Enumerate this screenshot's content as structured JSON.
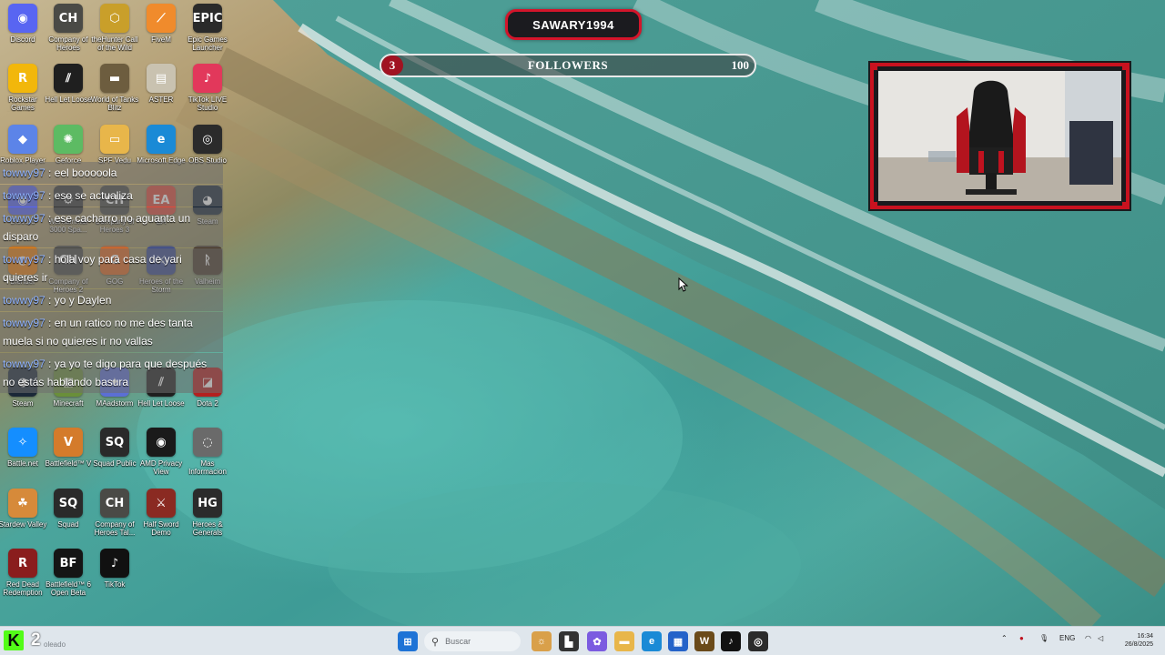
{
  "desktop_icons": [
    {
      "label": "Discord",
      "glyph": "◉",
      "color": "#5865f2",
      "icon": "discord-icon"
    },
    {
      "label": "Company of Heroes",
      "glyph": "CH",
      "color": "#4a4a46",
      "icon": "company-of-heroes-icon"
    },
    {
      "label": "theHunter Call of the Wild",
      "glyph": "⬡",
      "color": "#c99f2a",
      "icon": "thehunter-icon"
    },
    {
      "label": "FiveM",
      "glyph": "⟋",
      "color": "#f08b2c",
      "icon": "fivem-icon"
    },
    {
      "label": "Epic Games Launcher",
      "glyph": "EPIC",
      "color": "#2a2a2a",
      "icon": "epic-games-icon"
    },
    {
      "label": "Rockstar Games Launcher",
      "glyph": "R",
      "color": "#f2b70b",
      "icon": "rockstar-icon"
    },
    {
      "label": "Hell Let Loose",
      "glyph": "⫽",
      "color": "#1f1f1f",
      "icon": "hell-let-loose-icon"
    },
    {
      "label": "World of Tanks Blitz",
      "glyph": "▬",
      "color": "#6d5d3f",
      "icon": "world-of-tanks-icon"
    },
    {
      "label": "ASTER",
      "glyph": "▤",
      "color": "#c9c2b0",
      "icon": "aster-icon"
    },
    {
      "label": "TikTok LIVE Studio",
      "glyph": "♪",
      "color": "#e2385b",
      "icon": "tiktok-live-studio-icon"
    },
    {
      "label": "Roblox Player",
      "glyph": "◆",
      "color": "#5c84e8",
      "icon": "roblox-icon"
    },
    {
      "label": "Geforce",
      "glyph": "✺",
      "color": "#5dbb63",
      "icon": "geforce-icon"
    },
    {
      "label": "SPF Vedu",
      "glyph": "▭",
      "color": "#e8b64a",
      "icon": "folder-icon"
    },
    {
      "label": "Microsoft Edge",
      "glyph": "e",
      "color": "#1a8ad6",
      "icon": "edge-icon"
    },
    {
      "label": "OBS Studio",
      "glyph": "◎",
      "color": "#2b2b2b",
      "icon": "obs-icon"
    },
    {
      "label": "Discord",
      "glyph": "◉",
      "color": "#5865f2",
      "icon": "discord-icon"
    },
    {
      "label": "Warhammer 3000 Spa...",
      "glyph": "⚙",
      "color": "#3a3a3a",
      "icon": "warhammer-icon"
    },
    {
      "label": "Company of Heroes 3",
      "glyph": "CH",
      "color": "#4a4a46",
      "icon": "company-of-heroes-icon"
    },
    {
      "label": "EA",
      "glyph": "EA",
      "color": "#e04a3a",
      "icon": "ea-icon"
    },
    {
      "label": "Steam",
      "glyph": "◕",
      "color": "#1b2838",
      "icon": "steam-icon"
    },
    {
      "label": "Blender",
      "glyph": "◐",
      "color": "#e87d0d",
      "icon": "blender-icon"
    },
    {
      "label": "Company of Heroes 2",
      "glyph": "CH",
      "color": "#4a4a46",
      "icon": "company-of-heroes-icon"
    },
    {
      "label": "GOG",
      "glyph": "G",
      "color": "#e0661f",
      "icon": "gog-icon"
    },
    {
      "label": "Heroes of the Storm",
      "glyph": "⚔",
      "color": "#3b4b8f",
      "icon": "heroes-storm-icon"
    },
    {
      "label": "Valheim",
      "glyph": "ᚱ",
      "color": "#4b3a2a",
      "icon": "valheim-icon"
    },
    {
      "label": "Steam",
      "glyph": "◕",
      "color": "#1b2838",
      "icon": "steam-icon"
    },
    {
      "label": "Minecraft",
      "glyph": "▦",
      "color": "#6a8f3a",
      "icon": "minecraft-icon"
    },
    {
      "label": "MAadstorm",
      "glyph": "✦",
      "color": "#5b6fd4",
      "icon": "maadstorm-icon"
    },
    {
      "label": "Hell Let Loose",
      "glyph": "⫽",
      "color": "#1f1f1f",
      "icon": "hell-let-loose-icon"
    },
    {
      "label": "Dota 2",
      "glyph": "◪",
      "color": "#b3201f",
      "icon": "dota-icon"
    },
    {
      "label": "Battle.net",
      "glyph": "✧",
      "color": "#148eff",
      "icon": "battlenet-icon"
    },
    {
      "label": "Battlefield™ V",
      "glyph": "V",
      "color": "#d47b2b",
      "icon": "battlefield-v-icon"
    },
    {
      "label": "Squad Public",
      "glyph": "SQ",
      "color": "#2a2a2a",
      "icon": "squad-icon"
    },
    {
      "label": "AMD Privacy View",
      "glyph": "◉",
      "color": "#1a1a1a",
      "icon": "amd-privacy-view-icon"
    },
    {
      "label": "Mas Informacion",
      "glyph": "◌",
      "color": "#6a6a6a",
      "icon": "info-icon"
    },
    {
      "label": "Stardew Valley",
      "glyph": "☘",
      "color": "#d68a3a",
      "icon": "stardew-valley-icon"
    },
    {
      "label": "Squad",
      "glyph": "SQ",
      "color": "#2a2a2a",
      "icon": "squad-icon"
    },
    {
      "label": "Company of Heroes Tal...",
      "glyph": "CH",
      "color": "#4a4a46",
      "icon": "company-of-heroes-icon"
    },
    {
      "label": "Half Sword Demo",
      "glyph": "⚔",
      "color": "#8a2a22",
      "icon": "half-sword-icon"
    },
    {
      "label": "Heroes & Generals",
      "glyph": "HG",
      "color": "#2b2b2b",
      "icon": "heroes-generals-icon"
    },
    {
      "label": "Red Dead Redemption",
      "glyph": "R",
      "color": "#8a1d1d",
      "icon": "red-dead-icon"
    },
    {
      "label": "Battlefield™ 6 Open Beta",
      "glyph": "BF",
      "color": "#151515",
      "icon": "battlefield-6-icon"
    },
    {
      "label": "TikTok",
      "glyph": "♪",
      "color": "#111111",
      "icon": "tiktok-icon"
    }
  ],
  "overlay": {
    "streamer_name": "SAWARY1994",
    "followers_label": "FOLLOWERS",
    "followers_current": "3",
    "followers_goal": "100",
    "followers_progress": 0.03,
    "accent_color": "#d3152b"
  },
  "chat": {
    "messages": [
      {
        "user": "towwy97",
        "text": "eel booooola"
      },
      {
        "user": "towwy97",
        "text": "eso se actualiza"
      },
      {
        "user": "towwy97",
        "text": "ese cacharro no aguanta un disparo"
      },
      {
        "user": "towwy97",
        "text": "hola voy para casa de yari quieres ir"
      },
      {
        "user": "towwy97",
        "text": "yo y Daylen"
      },
      {
        "user": "towwy97",
        "text": "en un ratico no me des tanta muela si no quieres ir no vallas"
      },
      {
        "user": "towwy97",
        "text": "ya yo te digo para que después no estás hablando basura"
      }
    ]
  },
  "obs": {
    "k_letter": "K",
    "count": "2",
    "status_text": "oleado"
  },
  "taskbar": {
    "search_placeholder": "Buscar",
    "language": "ENG",
    "time": "16:34",
    "date": "26/8/2025",
    "apps": [
      {
        "icon": "windows-start-icon",
        "glyph": "⊞",
        "color": "#1e73d6"
      },
      {
        "icon": "cat-app-icon",
        "glyph": "☼",
        "color": "#d9a04a"
      },
      {
        "icon": "terminal-icon",
        "glyph": "▙",
        "color": "#333333"
      },
      {
        "icon": "copilot-icon",
        "glyph": "✿",
        "color": "#7b5be0"
      },
      {
        "icon": "file-explorer-icon",
        "glyph": "▬",
        "color": "#e8b64a"
      },
      {
        "icon": "edge-icon",
        "glyph": "e",
        "color": "#1a8ad6"
      },
      {
        "icon": "microsoft-store-icon",
        "glyph": "▦",
        "color": "#2563c9"
      },
      {
        "icon": "wow-icon",
        "glyph": "W",
        "color": "#6a4a1a"
      },
      {
        "icon": "tiktok-icon",
        "glyph": "♪",
        "color": "#111111"
      },
      {
        "icon": "obs-icon",
        "glyph": "◎",
        "color": "#2b2b2b"
      }
    ]
  }
}
